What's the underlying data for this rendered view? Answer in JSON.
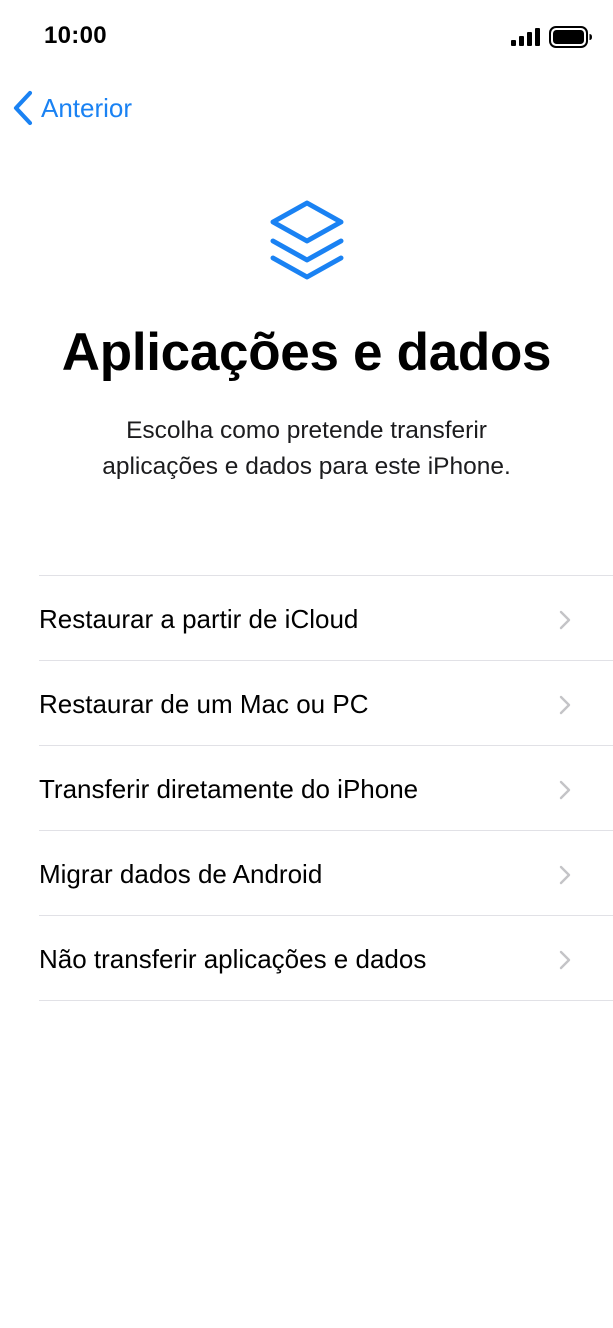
{
  "status_bar": {
    "time": "10:00",
    "signal_icon": "cellular-signal-icon",
    "battery_icon": "battery-full-icon"
  },
  "nav": {
    "back_label": "Anterior",
    "back_icon": "chevron-left-icon"
  },
  "header": {
    "icon": "layers-icon",
    "title": "Aplicações e dados",
    "subtitle_line1": "Escolha como pretende transferir",
    "subtitle_line2": "aplicações e dados para este iPhone."
  },
  "options": [
    {
      "label": "Restaurar a partir de iCloud"
    },
    {
      "label": "Restaurar de um Mac ou PC"
    },
    {
      "label": "Transferir diretamente do iPhone"
    },
    {
      "label": "Migrar dados de Android"
    },
    {
      "label": "Não transferir aplicações e dados"
    }
  ],
  "colors": {
    "accent": "#1a82f3",
    "separator": "#e1e1e6",
    "chevron": "#c4c4c7"
  }
}
